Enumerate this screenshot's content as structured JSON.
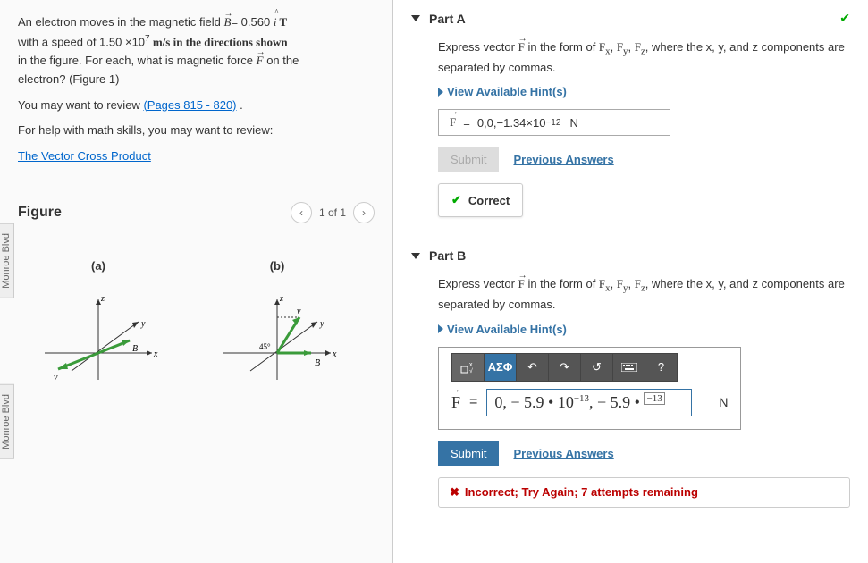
{
  "problem": {
    "line1_pre": "An electron moves in the magnetic field ",
    "Bvec": "B",
    "line1_post": "= 0.560 ",
    "ihat": "i",
    "unitT": " T",
    "line2_pre": "with a speed of 1.50 ×10",
    "speed_exp": "7",
    "line2_post": " m/s in the directions shown",
    "line3_pre": "in the figure. For each, what is magnetic force ",
    "Fvec": "F",
    "line3_post": " on the",
    "line4": "electron? (Figure 1)",
    "may_review": "You may want to review ",
    "pages_link": "(Pages 815 - 820)",
    "period": " .",
    "math_help": "For help with math skills, you may want to review:",
    "cross_product": "The Vector Cross Product"
  },
  "figure": {
    "title": "Figure",
    "count": "1 of 1",
    "sub_a": "(a)",
    "sub_b": "(b)",
    "angle_b": "45°"
  },
  "partA": {
    "title": "Part A",
    "prompt_pre": "Express vector ",
    "Fvec": "F",
    "prompt_mid": " in the form of ",
    "fx": "F",
    "fx_sub": "x",
    "fy": "F",
    "fy_sub": "y",
    "fz": "F",
    "fz_sub": "z",
    "prompt_post": ", where the x, y, and z components are separated by commas.",
    "hints": "View Available Hint(s)",
    "answer_var": "F",
    "answer_eq": "=",
    "answer_val": "0,0,−1.34×10",
    "answer_exp": "−12",
    "answer_unit": "N",
    "submit": "Submit",
    "prev": "Previous Answers",
    "correct": "Correct"
  },
  "partB": {
    "title": "Part B",
    "prompt_pre": "Express vector ",
    "Fvec": "F",
    "prompt_mid": " in the form of ",
    "fx": "F",
    "fx_sub": "x",
    "fy": "F",
    "fy_sub": "y",
    "fz": "F",
    "fz_sub": "z",
    "prompt_post": ", where the x, y, and z components are separated by commas.",
    "hints": "View Available Hint(s)",
    "greek_btn": "ΑΣΦ",
    "help_btn": "?",
    "answer_var": "F",
    "answer_eq": "=",
    "input_val": "0, − 5.9 • 10",
    "input_exp1": "−13",
    "input_val2": ", − 5.9 • ",
    "input_exp2": "−13",
    "answer_unit": "N",
    "submit": "Submit",
    "prev": "Previous Answers",
    "incorrect": "Incorrect; Try Again; 7 attempts remaining"
  }
}
